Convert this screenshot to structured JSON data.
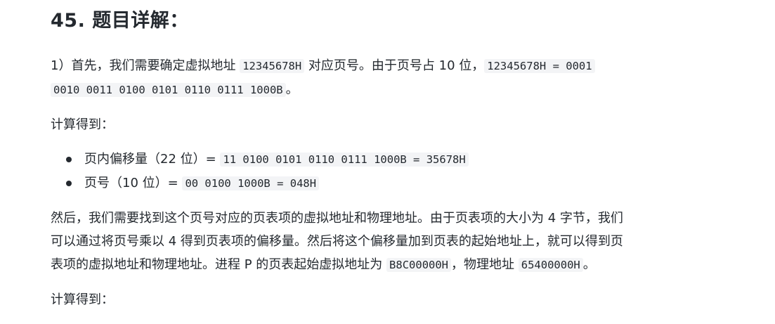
{
  "heading": "45. 题目详解：",
  "para1": {
    "t1": "1）首先，我们需要确定虚拟地址 ",
    "c1": "12345678H",
    "t2": " 对应页号。由于页号占 10 位，",
    "c2a": "12345678H = 0001",
    "c2b": "0010 0011 0100 0101 0110 0111 1000B",
    "t3": "。"
  },
  "calc_label_1": "计算得到：",
  "items": [
    {
      "text": "页内偏移量（22 位）= ",
      "code": "11 0100 0101 0110 0111 1000B = 35678H"
    },
    {
      "text": "页号（10 位）= ",
      "code": "00 0100 1000B = 048H"
    }
  ],
  "para3": {
    "line1": "然后，我们需要找到这个页号对应的页表项的虚拟地址和物理地址。由于页表项的大小为 4 字节，我们",
    "line2": "可以通过将页号乘以 4 得到页表项的偏移量。然后将这个偏移量加到页表的起始地址上，就可以得到页",
    "t3": "表项的虚拟地址和物理地址。进程 P 的页表起始虚拟地址为 ",
    "c1": "B8C00000H",
    "t4": "，物理地址 ",
    "c2": "65400000H",
    "t5": "。"
  },
  "calc_label_2": "计算得到："
}
